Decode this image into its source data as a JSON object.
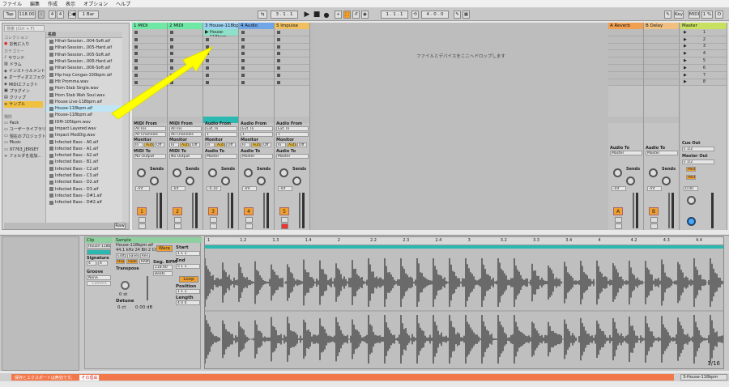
{
  "menu": [
    "ファイル",
    "編集",
    "作成",
    "表示",
    "オプション",
    "ヘルプ"
  ],
  "transport": {
    "tap": "Tap",
    "tempo": "118.00",
    "sig_num": "4",
    "sig_den": "4",
    "quant": "1 Bar",
    "pos_left": "3 . 1 . 1",
    "pos_right": "1 . 1 . 1",
    "loop_len": "4 . 0 . 0",
    "key": "Key",
    "midi": "MIDI",
    "cpu": "1 %",
    "d": "D"
  },
  "browser": {
    "search": "検索 (Ctrl + F)",
    "collections_title": "コレクション",
    "favorites": "お気に入り",
    "categories_title": "カテゴリー",
    "categories": [
      "サウンド",
      "ドラム",
      "インストゥルメント",
      "オーディオエフェクト",
      "MIDIエフェクト",
      "プラグイン",
      "クリップ",
      "サンプル"
    ],
    "places_title": "場所",
    "places": [
      "Pack",
      "ユーザーライブラリ",
      "現在のプロジェクト",
      "Music",
      "97763_JERSEY",
      "フォルダを追加..."
    ],
    "files_header": "名前",
    "files": [
      "Hihat-Session...004-Soft.aif",
      "Hihat-Session...005-Hard.aif",
      "Hihat-Session...005-Soft.aif",
      "Hihat-Session...006-Hard.aif",
      "Hihat-Session...006-Soft.aif",
      "Hip-hop Congas-100bpm.aif",
      "HIt Promma.wav",
      "Horn Stab Single.wav",
      "Horn Stab Wah Soul.wav",
      "House Live-118bpm.aif",
      "House-118bpm.aif",
      "House-118bpm.aif",
      "IDM-105bpm.wav",
      "Impact Layered.wav",
      "Impact ModDig.wav",
      "Infected Bass - A0.aif",
      "Infected Bass - A1.aif",
      "Infected Bass - A2.aif",
      "Infected Bass - B1.aif",
      "Infected Bass - C2.aif",
      "Infected Bass - C3.aif",
      "Infected Bass - D2.aif",
      "Infected Bass - D3.aif",
      "Infected Bass - D#1.aif",
      "Infected Bass - D#2.aif"
    ],
    "raw": "Raw"
  },
  "tracks": [
    {
      "name": "1 MIDI",
      "num": "1",
      "color": "#6fe8a6",
      "type": "midi"
    },
    {
      "name": "2 MIDI",
      "num": "2",
      "color": "#6fe8a6",
      "type": "midi"
    },
    {
      "name": "3 House-118bpm",
      "num": "3",
      "color": "#9ad0f0",
      "type": "audio"
    },
    {
      "name": "4 Audio",
      "num": "4",
      "color": "#6fa6e8",
      "type": "audio"
    },
    {
      "name": "5 Impulse",
      "num": "5",
      "color": "#f0c060",
      "type": "audio"
    }
  ],
  "returns": [
    {
      "name": "A Reverb",
      "num": "A",
      "color": "#f0a050"
    },
    {
      "name": "B Delay",
      "num": "B",
      "color": "#f0c080"
    }
  ],
  "master": {
    "name": "Master",
    "color": "#c8e060",
    "scenes": [
      "1",
      "2",
      "3",
      "4",
      "5",
      "6",
      "7",
      "8"
    ],
    "cue_out": "Cue Out",
    "cue_val": "ii 1/2",
    "master_out": "Master Out",
    "master_val": "ii 1/2"
  },
  "clip_playing": "House-118bpm",
  "io": {
    "midi_from": "MIDI From",
    "all_ins": "All Ins",
    "all_channels": "All Channels",
    "audio_from": "Audio From",
    "ext_in": "Ext. In",
    "ch1": "1",
    "monitor": "Monitor",
    "in": "In",
    "auto": "Auto",
    "off": "Off",
    "midi_to": "MIDI To",
    "no_output": "No Output",
    "audio_to": "Audio To",
    "master": "Master",
    "sends": "Sends",
    "inf": "-Inf",
    "vol3": "-0.10",
    "master_vol": "0.00",
    "post": "Post"
  },
  "dropzone": "ファイルとデバイスをここへドロップします",
  "clip": {
    "clip_label": "Clip",
    "clip_name": "House-118bp",
    "sig_label": "Signature",
    "sig_a": "4",
    "sig_b": "4",
    "groove_label": "Groove",
    "groove_val": "None",
    "commit": "Commit",
    "sample_label": "Sample",
    "sample_name": "House-118bpm.aif",
    "sample_info": "44.1 kHz 24 Bit 2 Ch",
    "warp": "Warp",
    "hiq": "HiQ",
    "fade": "Fade",
    "ram": "RAM",
    "transpose_label": "Transpose",
    "transpose_val": "0 st",
    "detune_label": "Detune",
    "detune_val": "0 ct",
    "gain_val": "0.00 dB",
    "seg_bpm_label": "Seg. BPM",
    "seg_bpm": "118.00",
    "beats": "Beats",
    "start_label": "Start",
    "start_val": "1  1  1",
    "end_label": "End",
    "end_val": "5  1  1",
    "loop": "Loop",
    "position_label": "Position",
    "position_val": "1  1  1",
    "length_label": "Length",
    "length_val": "4  0  0",
    "edit": "Edit",
    "save": "Save",
    "rev": "Rev."
  },
  "ruler": [
    "1",
    "1.2",
    "1.3",
    "1.4",
    "2",
    "2.2",
    "2.3",
    "2.4",
    "3",
    "3.2",
    "3.3",
    "3.4",
    "4",
    "4.2",
    "4.3",
    "4.4"
  ],
  "grid": "1/16",
  "status": {
    "message": "保存とエクスポートは無効です。",
    "link": "その理由",
    "track": "3-House-118bpm"
  }
}
